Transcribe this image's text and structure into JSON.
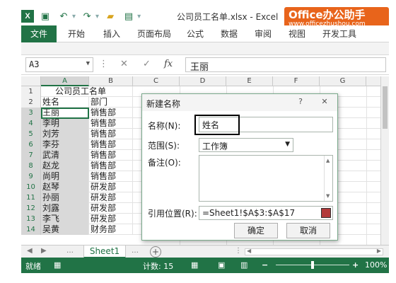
{
  "window": {
    "title": "公司员工名单.xlsx - Excel",
    "brand_line1": "Office办公助手",
    "brand_line2": "www.officezhushou.com"
  },
  "ribbon": {
    "tabs": [
      "文件",
      "开始",
      "插入",
      "页面布局",
      "公式",
      "数据",
      "审阅",
      "视图",
      "开发工具"
    ]
  },
  "formula_bar": {
    "name_box": "A3",
    "content": "王丽"
  },
  "sheet": {
    "columns": [
      "A",
      "B",
      "C",
      "D",
      "E",
      "F",
      "G"
    ],
    "rows": [
      {
        "num": "1",
        "a": "公司员工名单",
        "b": ""
      },
      {
        "num": "2",
        "a": "姓名",
        "b": "部门"
      },
      {
        "num": "3",
        "a": "王丽",
        "b": "销售部"
      },
      {
        "num": "4",
        "a": "李明",
        "b": "销售部"
      },
      {
        "num": "5",
        "a": "刘芳",
        "b": "销售部"
      },
      {
        "num": "6",
        "a": "李芬",
        "b": "销售部"
      },
      {
        "num": "7",
        "a": "武清",
        "b": "销售部"
      },
      {
        "num": "8",
        "a": "赵龙",
        "b": "销售部"
      },
      {
        "num": "9",
        "a": "尚明",
        "b": "销售部"
      },
      {
        "num": "10",
        "a": "赵琴",
        "b": "研发部"
      },
      {
        "num": "11",
        "a": "孙丽",
        "b": "研发部"
      },
      {
        "num": "12",
        "a": "刘露",
        "b": "研发部"
      },
      {
        "num": "13",
        "a": "李飞",
        "b": "研发部"
      },
      {
        "num": "14",
        "a": "吴黄",
        "b": "财务部"
      }
    ],
    "tab_name": "Sheet1"
  },
  "status_bar": {
    "ready": "就绪",
    "count": "计数: 15",
    "zoom": "100%"
  },
  "dialog": {
    "title": "新建名称",
    "help": "?",
    "close": "✕",
    "name_label": "名称(N):",
    "name_value": "姓名",
    "scope_label": "范围(S):",
    "scope_value": "工作簿",
    "comment_label": "备注(O):",
    "comment_value": "",
    "ref_label": "引用位置(R):",
    "ref_value": "=Sheet1!$A$3:$A$17",
    "ok": "确定",
    "cancel": "取消"
  }
}
